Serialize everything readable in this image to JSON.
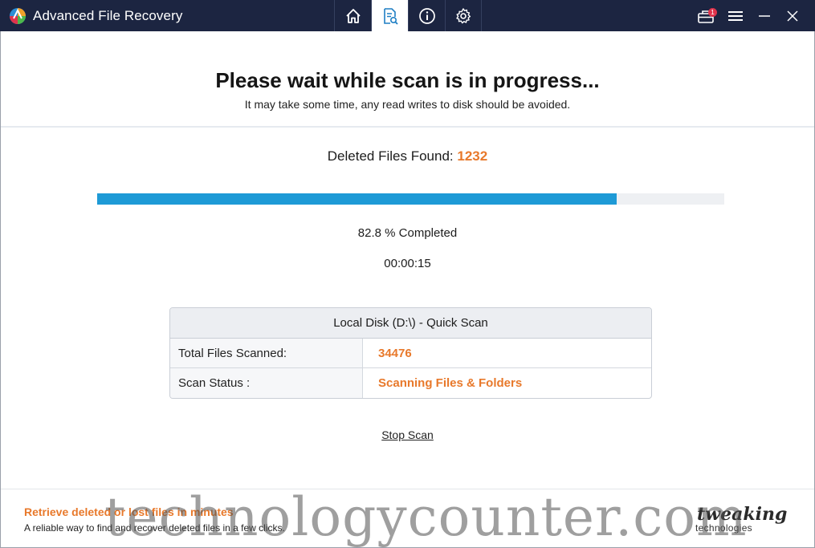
{
  "window": {
    "title": "Advanced File Recovery"
  },
  "nav": {
    "tabs": [
      {
        "icon": "home-icon",
        "active": false
      },
      {
        "icon": "scan-icon",
        "active": true
      },
      {
        "icon": "info-icon",
        "active": false
      },
      {
        "icon": "gear-icon",
        "active": false
      }
    ],
    "notification_count": "1"
  },
  "scan": {
    "heading": "Please wait while scan is in progress...",
    "subheading": "It may take some time, any read writes to disk should be avoided.",
    "found_label": "Deleted Files Found: ",
    "found_count": "1232",
    "progress_fraction": 0.828,
    "progress_text": "82.8 % Completed",
    "elapsed": "00:00:15"
  },
  "details": {
    "header": "Local Disk (D:\\) - Quick Scan",
    "rows": [
      {
        "label": "Total Files Scanned:",
        "value": "34476"
      },
      {
        "label": "Scan Status :",
        "value": "Scanning Files & Folders"
      }
    ]
  },
  "actions": {
    "stop_label": "Stop Scan"
  },
  "footer": {
    "promo_title": "Retrieve deleted or lost files in minutes",
    "promo_sub": "A reliable way to find and recover deleted files in a few clicks.",
    "brand_line1": "tweaking",
    "brand_line2": "technologies"
  },
  "watermark": "technologycounter.com",
  "colors": {
    "titlebar": "#1c2541",
    "accent_orange": "#e8792b",
    "progress_blue": "#1e9ad6"
  }
}
